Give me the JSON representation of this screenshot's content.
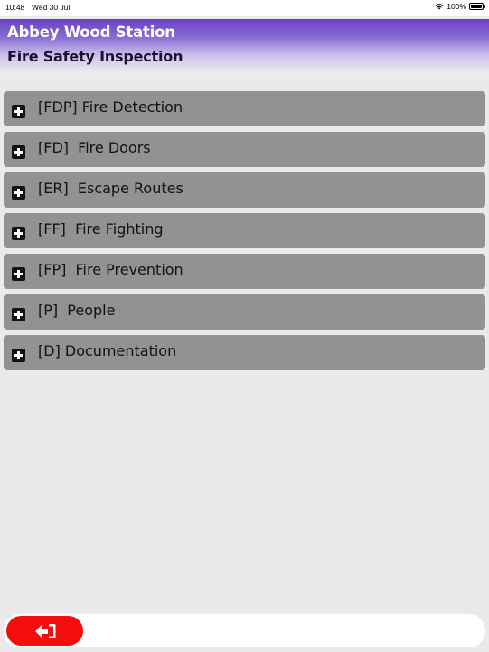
{
  "status_bar": {
    "time": "10:48",
    "date": "Wed 30 Jul",
    "battery": "100%",
    "icons": [
      "wifi-icon",
      "battery-icon"
    ]
  },
  "header": {
    "title": "Abbey Wood Station",
    "subtitle": "Fire Safety Inspection",
    "gradient_top": "#6a3fc4",
    "gradient_bottom": "#eeeeee"
  },
  "sections": [
    {
      "label": "[FDP] Fire Detection",
      "icon": "plus-square-icon"
    },
    {
      "label": "[FD]  Fire Doors",
      "icon": "plus-square-icon"
    },
    {
      "label": "[ER]  Escape Routes",
      "icon": "plus-square-icon"
    },
    {
      "label": "[FF]  Fire Fighting",
      "icon": "plus-square-icon"
    },
    {
      "label": "[FP]  Fire Prevention",
      "icon": "plus-square-icon"
    },
    {
      "label": "[P]  People",
      "icon": "plus-square-icon"
    },
    {
      "label": "[D] Documentation",
      "icon": "plus-square-icon"
    }
  ],
  "bottom_bar": {
    "exit_icon": "sign-out-icon",
    "exit_color": "#f40d0d"
  },
  "colors": {
    "background": "#eaeaea",
    "section_row": "#929292"
  }
}
